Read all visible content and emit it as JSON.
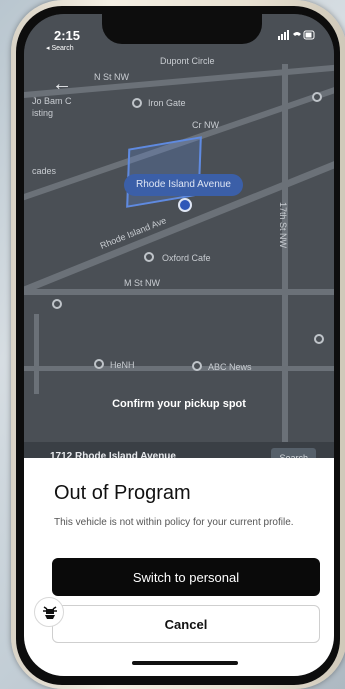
{
  "status_bar": {
    "time": "2:15",
    "back_app": "◂ Search"
  },
  "map": {
    "labels": {
      "dupont_circle": "Dupont Circle",
      "n_st_top": "N St NW",
      "iron_gate": "Iron Gate",
      "left_top": "Jo Bam C",
      "left_top2": "isting",
      "cr_nw": "Cr NW",
      "cascades": "cades",
      "rhode_island_ave": "Rhode Island Avenue",
      "rhode_island_road": "Rhode Island Ave",
      "street_17th": "17th St NW",
      "oxford_cafe": "Oxford Cafe",
      "m_st": "M St NW",
      "henh": "HeNH",
      "abc_news": "ABC News"
    }
  },
  "confirm_text": "Confirm your pickup spot",
  "address": {
    "text": "1712 Rhode Island Avenue",
    "search_label": "Search"
  },
  "sheet": {
    "title": "Out of Program",
    "description": "This vehicle is not within policy for your current profile.",
    "primary_button": "Switch to personal",
    "secondary_button": "Cancel"
  },
  "colors": {
    "accent": "#0a0a0a",
    "map_bg": "#4a4f55",
    "pickup_pill": "#3b5fa8"
  }
}
